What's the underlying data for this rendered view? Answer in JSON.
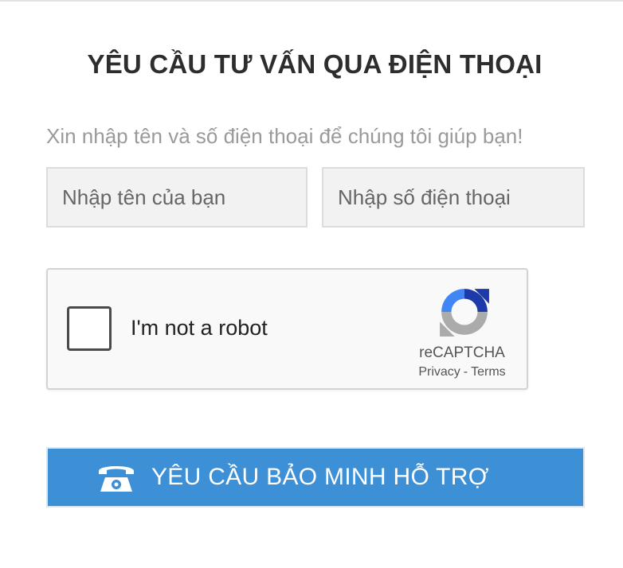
{
  "form": {
    "title": "YÊU CẦU TƯ VẤN QUA ĐIỆN THOẠI",
    "subtitle": "Xin nhập tên và số điện thoại để chúng tôi giúp bạn!",
    "name_field": {
      "placeholder": "Nhập tên của bạn",
      "value": ""
    },
    "phone_field": {
      "placeholder": "Nhập số điện thoại",
      "value": ""
    },
    "submit": {
      "label": "YÊU CẦU BẢO MINH HỖ TRỢ",
      "icon": "telephone-icon"
    }
  },
  "recaptcha": {
    "checkbox_label": "I'm not a robot",
    "checked": false,
    "brand": "reCAPTCHA",
    "privacy_link": "Privacy",
    "separator": "-",
    "terms_link": "Terms",
    "icon": "recaptcha-logo-icon"
  },
  "colors": {
    "accent": "#3d8fd6",
    "title": "#2d2d2d",
    "subtitle": "#9a9a9a",
    "field_bg": "#f2f2f2"
  }
}
